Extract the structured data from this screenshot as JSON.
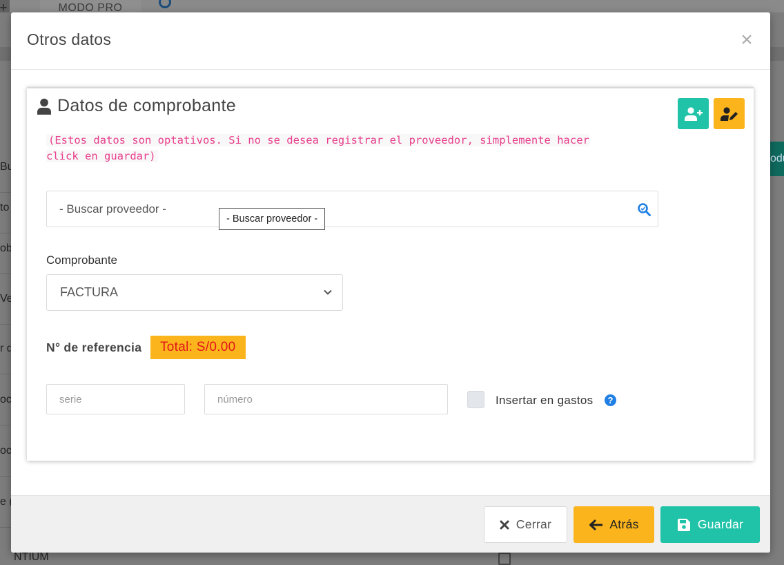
{
  "background": {
    "tab_label": "MODO PRO",
    "bottom_text": "NTIUM",
    "green_button_text": "odu",
    "search_fragment": "Bu",
    "rows": [
      "to",
      "ob",
      "Ve",
      "r d",
      "oca",
      "oca",
      "e ("
    ]
  },
  "modal": {
    "title": "Otros datos",
    "close_symbol": "×"
  },
  "card": {
    "title": "Datos de comprobante",
    "note": "(Estos datos son optativos. Si no se desea registrar el proveedor, simplemente hacer click en guardar)"
  },
  "supplier_search": {
    "placeholder": "- Buscar proveedor -",
    "tooltip": "- Buscar proveedor -"
  },
  "voucher": {
    "label": "Comprobante",
    "selected": "FACTURA"
  },
  "reference": {
    "label": "N° de referencia",
    "total": "Total: S/0.00"
  },
  "fields": {
    "series_placeholder": "serie",
    "number_placeholder": "número"
  },
  "insert_expenses": {
    "label": "Insertar en gastos",
    "help_symbol": "?"
  },
  "footer": {
    "close_label": "Cerrar",
    "back_label": "Atrás",
    "save_label": "Guardar"
  },
  "colors": {
    "teal": "#20c3a8",
    "amber": "#fbb41c",
    "total_red": "#e3151a",
    "note_pink": "#e83e8c",
    "help_blue": "#1f7fe5"
  }
}
